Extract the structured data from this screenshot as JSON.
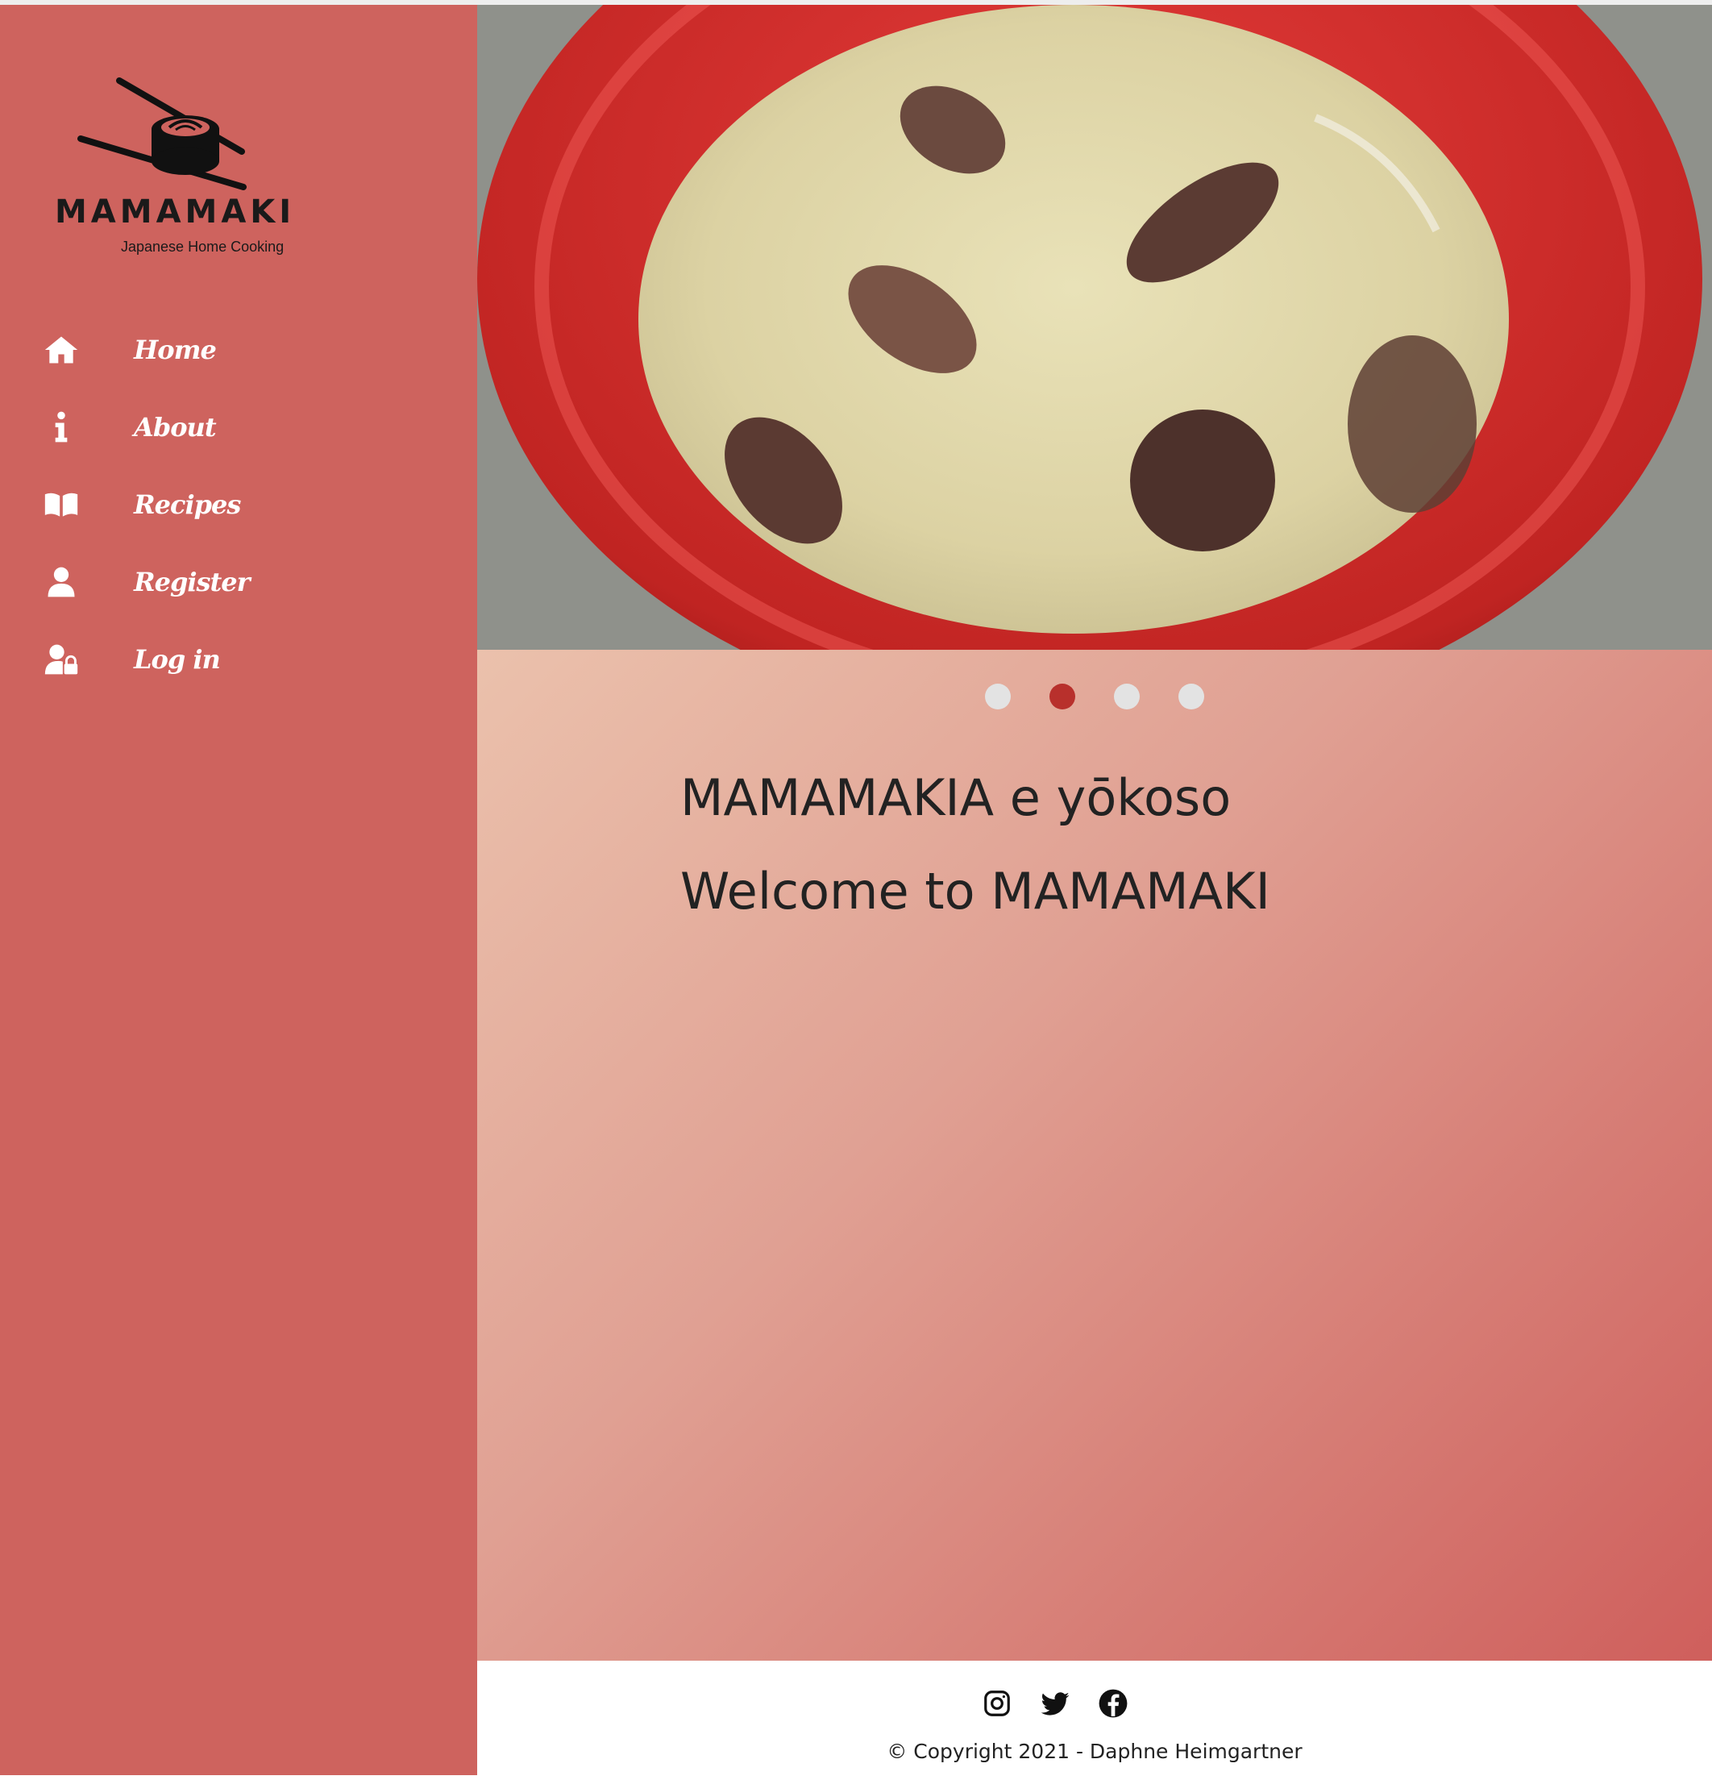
{
  "brand": {
    "name": "MAMAMAKI",
    "tagline": "Japanese Home Cooking"
  },
  "nav": {
    "items": [
      {
        "label": "Home",
        "icon": "home-icon"
      },
      {
        "label": "About",
        "icon": "info-icon"
      },
      {
        "label": "Recipes",
        "icon": "book-icon"
      },
      {
        "label": "Register",
        "icon": "user-icon"
      },
      {
        "label": "Log in",
        "icon": "user-lock-icon"
      }
    ]
  },
  "hero": {
    "carousel_count": 4,
    "active_slide": 2
  },
  "welcome": {
    "line1": "MAMAMAKIA e yōkoso",
    "line2": "Welcome to MAMAMAKI"
  },
  "footer": {
    "socials": [
      "instagram-icon",
      "twitter-icon",
      "facebook-icon"
    ],
    "copyright": "© Copyright 2021 - Daphne Heimgartner"
  },
  "colors": {
    "sidebar": "#ce635e",
    "active_dot": "#b8302c",
    "inactive_dot": "#e3e3e3"
  }
}
